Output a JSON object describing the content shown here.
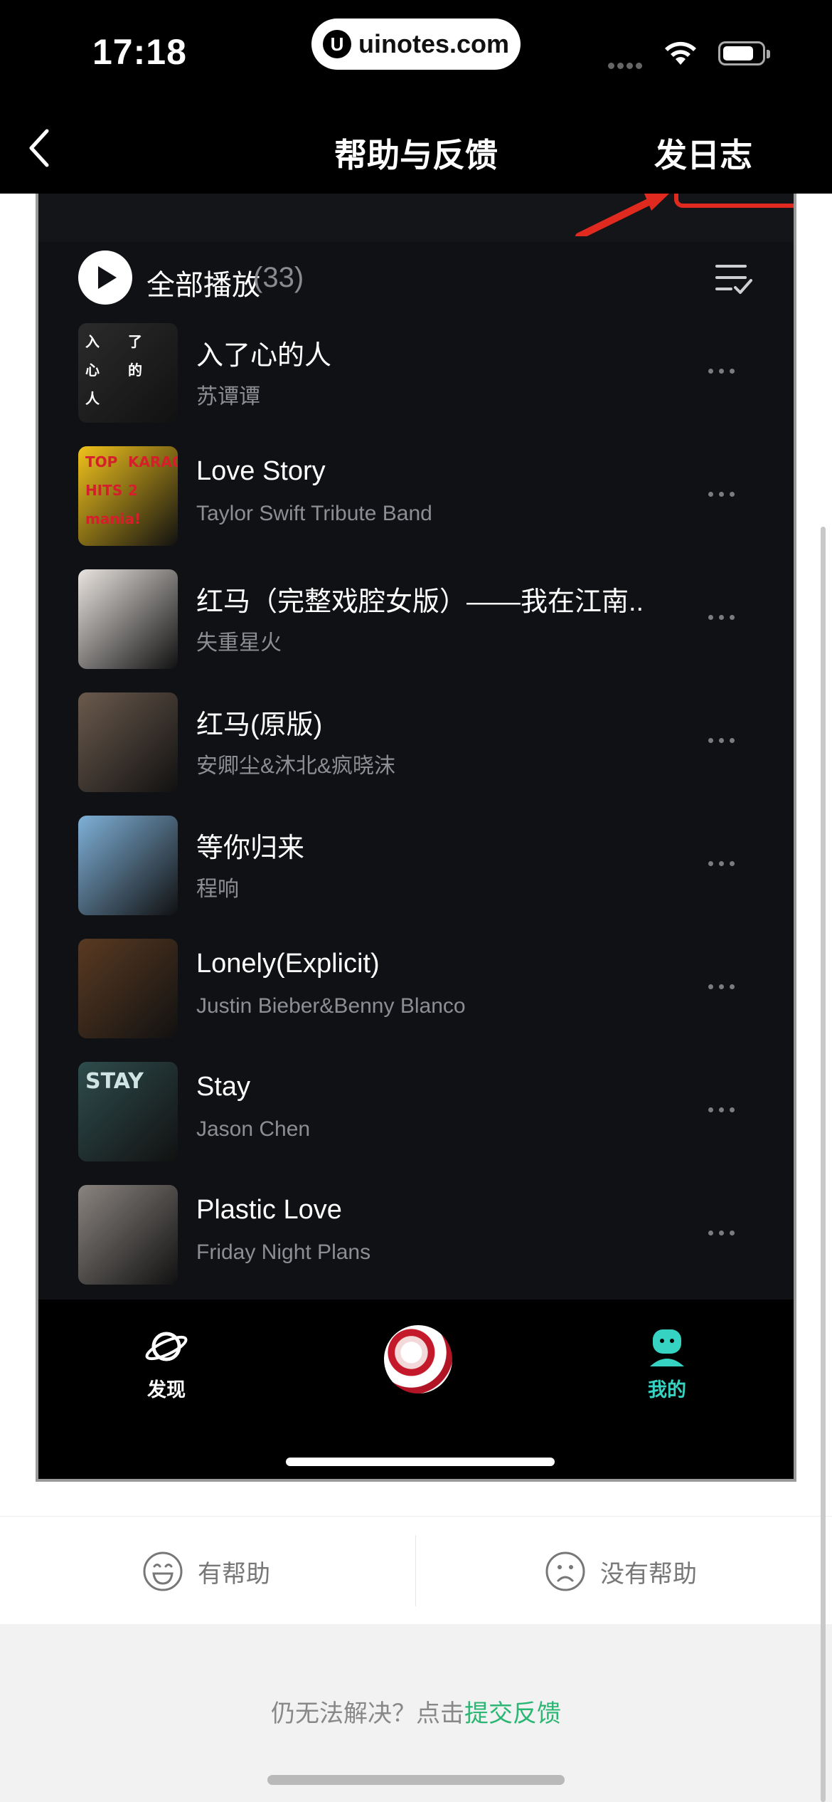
{
  "status_bar": {
    "time": "17:18",
    "url": "uinotes.com",
    "url_logo": "U"
  },
  "nav": {
    "title": "帮助与反馈",
    "right_action": "发日志"
  },
  "player": {
    "play_all_label": "全部播放",
    "count": "(33)",
    "songs": [
      {
        "title": "入了心的人",
        "artist": "苏谭谭",
        "cover": {
          "bg": "#2b2b2b",
          "fg": "#ffffff",
          "glyphs": [
            "入",
            "了",
            "心",
            "的",
            "人"
          ]
        }
      },
      {
        "title": "Love Story",
        "artist": "Taylor Swift Tribute Band",
        "cover": {
          "bg": "#f0c21c",
          "fg": "#d5202b",
          "glyphs": [
            "TOP",
            "KARAOKE",
            "HITS",
            "2",
            "mania!"
          ]
        }
      },
      {
        "title": "红马（完整戏腔女版）——我在江南..",
        "artist": "失重星火",
        "cover": {
          "bg": "#e9e4e0",
          "fg": "#1a1a1a",
          "glyphs": []
        }
      },
      {
        "title": "红马(原版)",
        "artist": "安卿尘&沐北&疯晓沫",
        "cover": {
          "bg": "#6b5a4d",
          "fg": "#f2e6da",
          "glyphs": []
        }
      },
      {
        "title": "等你归来",
        "artist": "程响",
        "cover": {
          "bg": "#7fb0d8",
          "fg": "#ffffff",
          "glyphs": []
        }
      },
      {
        "title": "Lonely(Explicit)",
        "artist": "Justin Bieber&Benny Blanco",
        "cover": {
          "bg": "#5a3a22",
          "fg": "#d8a45a",
          "glyphs": []
        }
      },
      {
        "title": "Stay",
        "artist": "Jason Chen",
        "cover": {
          "bg": "#2f4c4d",
          "fg": "#cfe3e2",
          "glyphs": [
            "STAY"
          ]
        }
      },
      {
        "title": "Plastic Love",
        "artist": "Friday Night Plans",
        "cover": {
          "bg": "#8a8480",
          "fg": "#1a1a1a",
          "glyphs": []
        }
      }
    ],
    "tabs": [
      {
        "label": "发现",
        "color": "#ffffff"
      },
      {
        "label": "我的",
        "color": "#36d3c2"
      }
    ]
  },
  "feedback": {
    "helpful": "有帮助",
    "not_helpful": "没有帮助"
  },
  "footer": {
    "prefix": "仍无法解决？点击",
    "link": "提交反馈"
  }
}
